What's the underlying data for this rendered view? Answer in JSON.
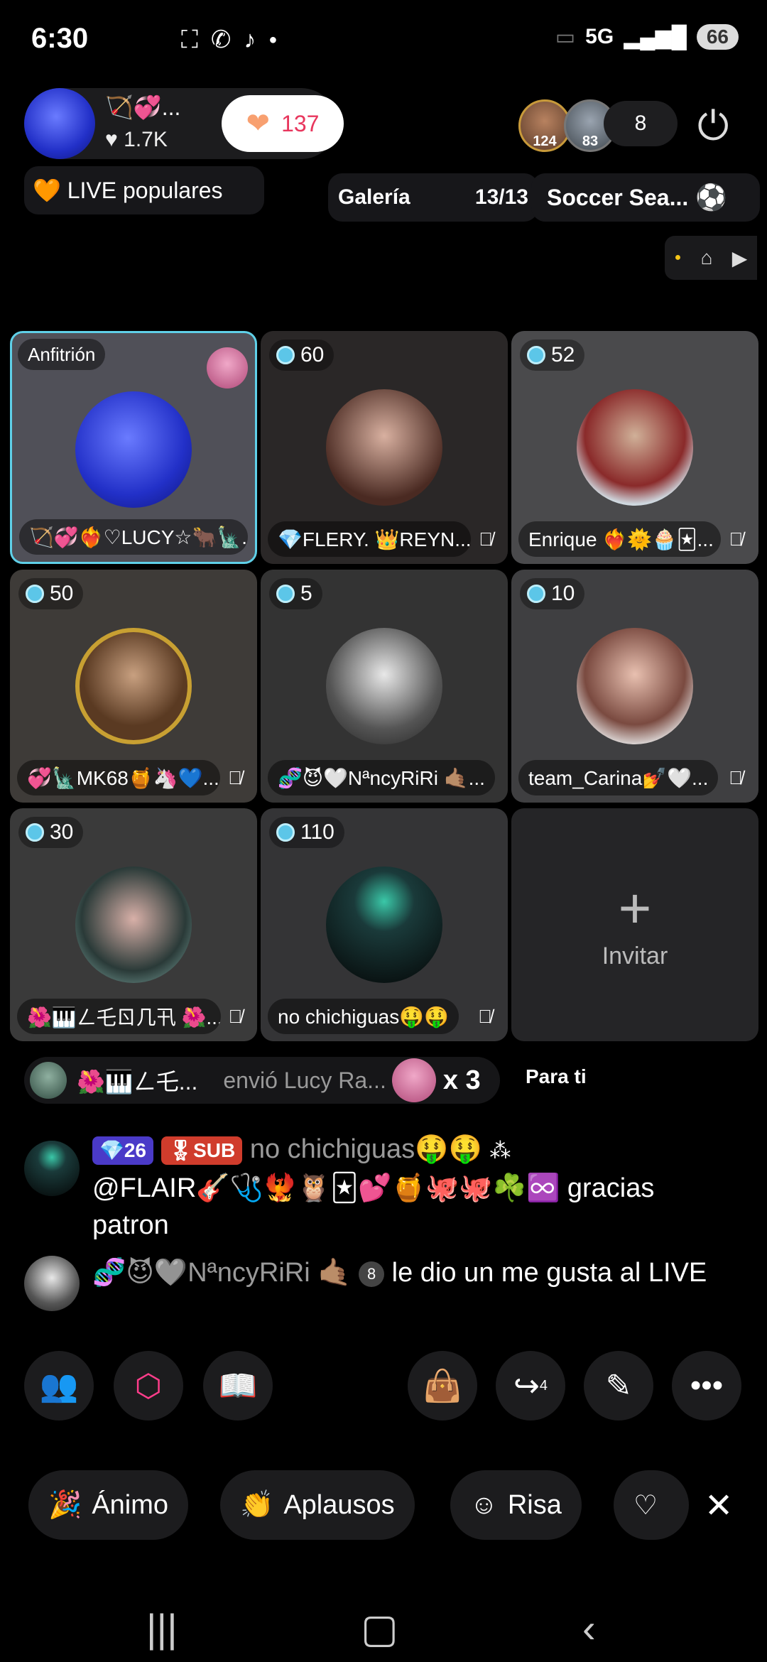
{
  "status": {
    "time": "6:30",
    "network": "5G",
    "battery": "66"
  },
  "host": {
    "name": "🏹💞...",
    "likes": "♥ 1.7K",
    "score": "137"
  },
  "viewers": {
    "v1_level": "124",
    "v2_level": "83",
    "count": "8"
  },
  "chips": {
    "popular": "🧡 LIVE populares",
    "gallery": "Galería",
    "gallery_count": "13/13",
    "soccer": "Soccer Sea..."
  },
  "grid": {
    "host_badge": "Anfitrión",
    "tiles": [
      {
        "name": "🏹💞❤️‍🔥♡LUCY☆🐂🗽..."
      },
      {
        "score": "60",
        "name": "💎FLERY. 👑REYN..."
      },
      {
        "score": "52",
        "name": "Enrique ❤️‍🔥🌞🧁🃏..."
      },
      {
        "score": "50",
        "name": "💞🗽MK68🍯🦄💙..."
      },
      {
        "score": "5",
        "name": "🧬😈🤍NªncyRiRi 🤙🏽..."
      },
      {
        "score": "10",
        "name": "team_Carina💅🤍..."
      },
      {
        "score": "30",
        "name": "🌺🎹ㄥ乇ㄖ几卂 🌺..."
      },
      {
        "score": "110",
        "name": "no chichiguas🤑🤑"
      }
    ],
    "invite": "Invitar"
  },
  "gift": {
    "sender": "🌺🎹ㄥ乇...",
    "text": "envió Lucy Ra...",
    "multiplier": "x 3",
    "for_you": "Para ti"
  },
  "comments": [
    {
      "level": "💎26",
      "sub": "🎖SUB",
      "user": "no chichiguas🤑🤑",
      "text": "@FLAIR🎸🩺🐦‍🔥🦉🃏💕🍯🐙🐙☘️♾️ gracias patron"
    },
    {
      "user": "🧬😈🩶NªncyRiRi 🤙🏽",
      "level": "8",
      "text": "le dio un me gusta al LIVE"
    }
  ],
  "actions": {
    "share_count": "4"
  },
  "quick": {
    "q1": "Ánimo",
    "q2": "Aplausos",
    "q3": "Risa"
  },
  "colors": {
    "accent": "#ff3d8b",
    "host_border": "#5fd0e8",
    "heart_number": "#e8365d"
  }
}
